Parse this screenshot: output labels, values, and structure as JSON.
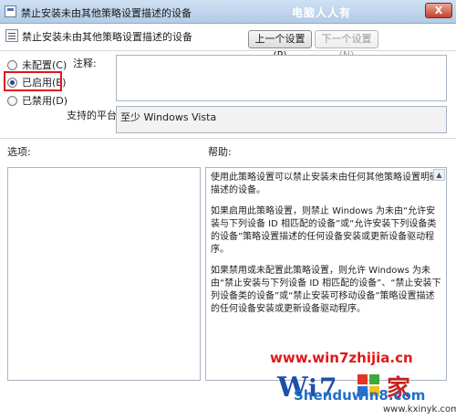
{
  "window": {
    "title": "禁止安装未由其他策略设置描述的设备",
    "watermark_top": "电脑人人有",
    "close_label": "X"
  },
  "header": {
    "policy_name": "禁止安装未由其他策略设置描述的设备",
    "prev_button": "上一个设置(P)",
    "next_button": "下一个设置(N)"
  },
  "state": {
    "options": [
      {
        "label": "未配置(C)",
        "checked": false
      },
      {
        "label": "已启用(E)",
        "checked": true
      },
      {
        "label": "已禁用(D)",
        "checked": false
      }
    ]
  },
  "fields": {
    "comment_label": "注释:",
    "comment_value": "",
    "platform_label": "支持的平台:",
    "platform_value": "至少 Windows Vista"
  },
  "sections": {
    "options_label": "选项:",
    "help_label": "帮助:"
  },
  "help": {
    "paragraphs": [
      "使用此策略设置可以禁止安装未由任何其他策略设置明确描述的设备。",
      "如果启用此策略设置，则禁止 Windows 为未由“允许安装与下列设备 ID 相匹配的设备”或“允许安装下列设备类的设备”策略设置描述的任何设备安装或更新设备驱动程序。",
      "如果禁用或未配置此策略设置，则允许 Windows 为未由“禁止安装与下列设备 ID 相匹配的设备”、“禁止安装下列设备类的设备”或“禁止安装可移动设备”策略设置描述的任何设备安装或更新设备驱动程序。"
    ]
  },
  "watermark": {
    "url": "www.win7zhijia.cn",
    "site": "Shenduwin8.com",
    "site2": "www.kxinyk.com"
  },
  "colors": {
    "highlight": "#e2141e",
    "watermark_red": "#e11818",
    "watermark_blue": "#1f6fc8"
  }
}
